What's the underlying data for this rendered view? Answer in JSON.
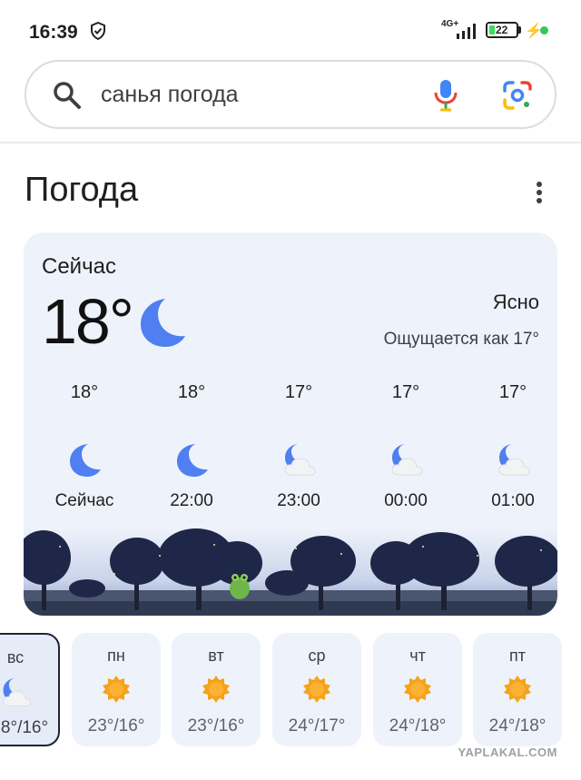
{
  "status": {
    "time": "16:39",
    "network": "4G+",
    "battery": "22"
  },
  "search": {
    "query": "санья погода"
  },
  "weather": {
    "title": "Погода",
    "now_label": "Сейчас",
    "now_temp": "18°",
    "condition": "Ясно",
    "feels_like": "Ощущается как 17°",
    "hourly": [
      {
        "temp": "18°",
        "time": "Сейчас",
        "icon": "moon-icon"
      },
      {
        "temp": "18°",
        "time": "22:00",
        "icon": "moon-icon"
      },
      {
        "temp": "17°",
        "time": "23:00",
        "icon": "moon-cloud-icon"
      },
      {
        "temp": "17°",
        "time": "00:00",
        "icon": "moon-cloud-icon"
      },
      {
        "temp": "17°",
        "time": "01:00",
        "icon": "moon-cloud-icon"
      }
    ],
    "days": [
      {
        "name": "вс",
        "temps": "8°/16°",
        "icon": "moon-cloud-icon",
        "selected": true
      },
      {
        "name": "пн",
        "temps": "23°/16°",
        "icon": "sun-icon"
      },
      {
        "name": "вт",
        "temps": "23°/16°",
        "icon": "sun-icon"
      },
      {
        "name": "ср",
        "temps": "24°/17°",
        "icon": "sun-icon"
      },
      {
        "name": "чт",
        "temps": "24°/18°",
        "icon": "sun-icon"
      },
      {
        "name": "пт",
        "temps": "24°/18°",
        "icon": "sun-icon"
      }
    ]
  },
  "watermark": "YAPLAKAL.COM",
  "colors": {
    "moon": "#4f7ff0",
    "sun": "#f6a21a",
    "card": "#eef2fb"
  }
}
